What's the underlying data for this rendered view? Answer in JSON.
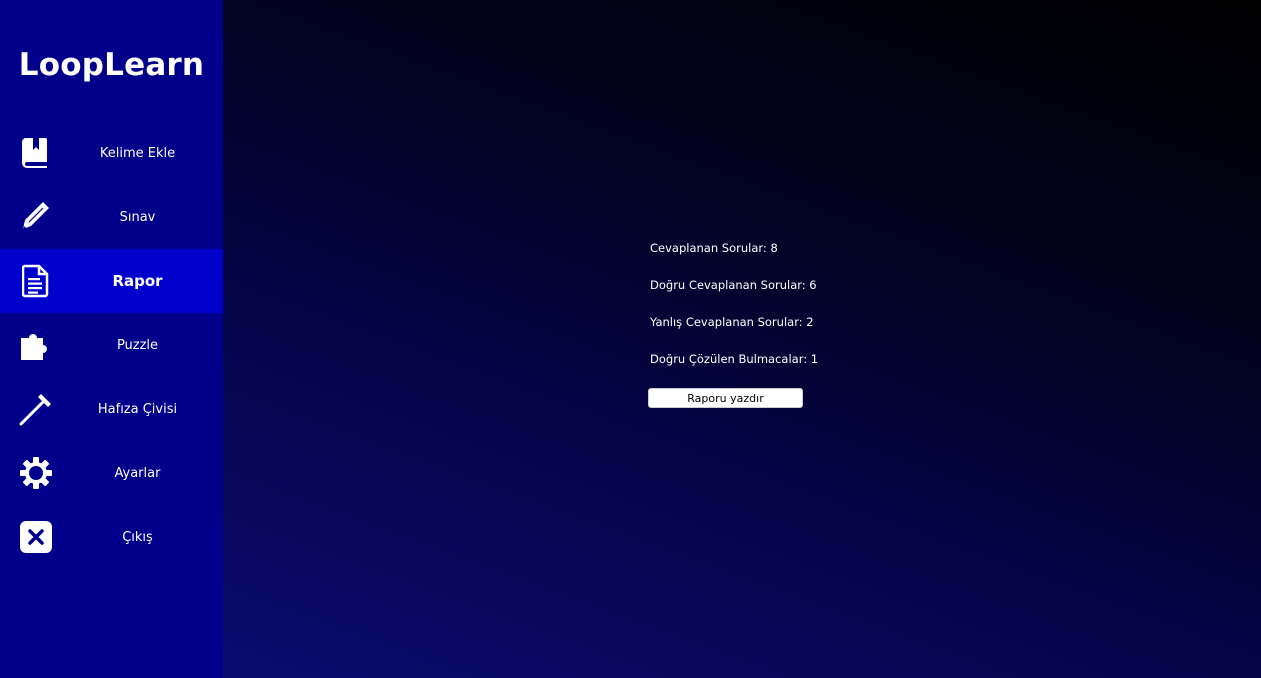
{
  "app": {
    "title": "LoopLearn"
  },
  "sidebar": {
    "items": [
      {
        "label": "Kelime Ekle",
        "icon": "book-icon",
        "active": false
      },
      {
        "label": "Sınav",
        "icon": "pencil-icon",
        "active": false
      },
      {
        "label": "Rapor",
        "icon": "document-icon",
        "active": true
      },
      {
        "label": "Puzzle",
        "icon": "puzzle-icon",
        "active": false
      },
      {
        "label": "Hafıza Çivisi",
        "icon": "nail-icon",
        "active": false
      },
      {
        "label": "Ayarlar",
        "icon": "gear-icon",
        "active": false
      },
      {
        "label": "Çıkış",
        "icon": "close-icon",
        "active": false
      }
    ]
  },
  "report": {
    "stats": [
      {
        "key": "Cevaplanan Sorular:",
        "value": "8"
      },
      {
        "key": "Doğru Cevaplanan Sorular:",
        "value": "6"
      },
      {
        "key": "Yanlış Cevaplanan Sorular:",
        "value": "2"
      },
      {
        "key": "Doğru Çözülen Bulmacalar:",
        "value": "1"
      }
    ],
    "print_label": "Raporu yazdır"
  },
  "colors": {
    "sidebar_bg": "#00008b",
    "sidebar_active_bg": "#0000cd",
    "text": "#ffffff"
  }
}
